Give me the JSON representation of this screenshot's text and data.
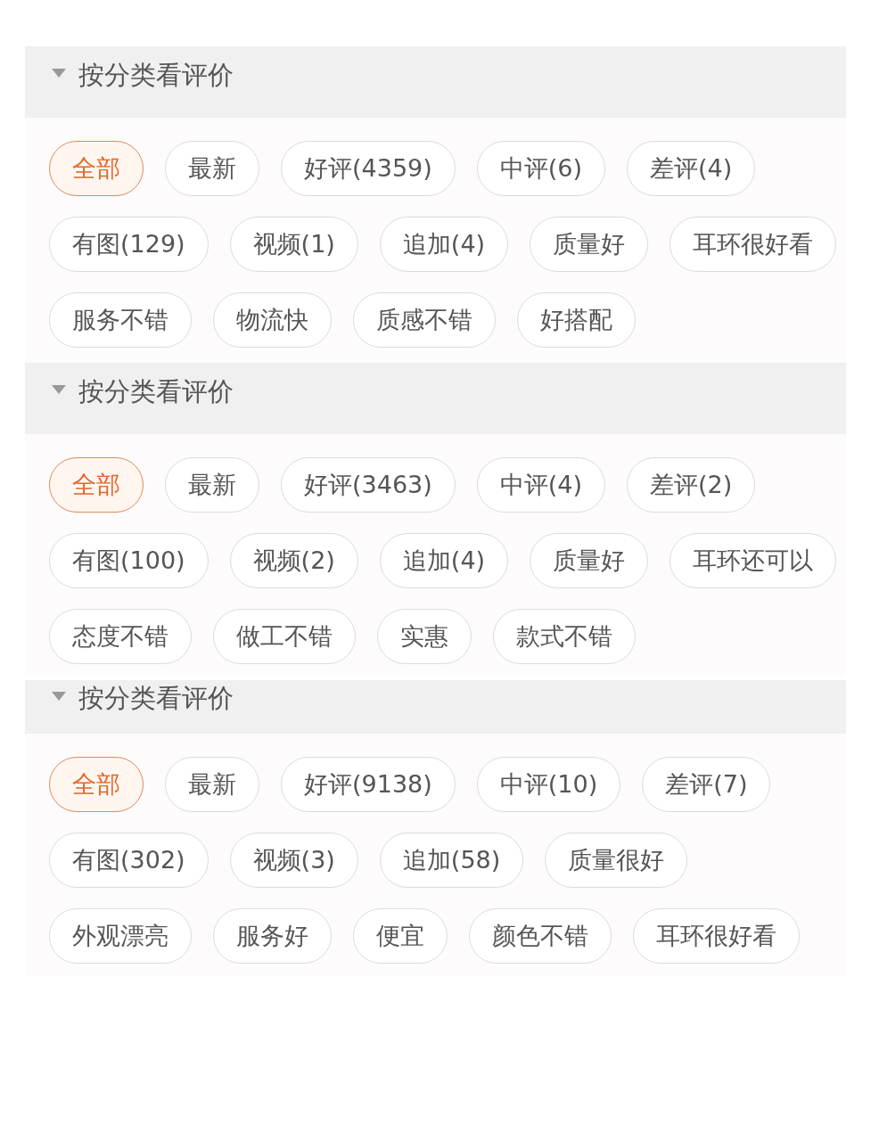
{
  "sections": [
    {
      "title": "按分类看评价",
      "expanded": true,
      "tags": [
        {
          "label": "全部",
          "selected": true
        },
        {
          "label": "最新",
          "selected": false
        },
        {
          "label": "好评(4359)",
          "selected": false
        },
        {
          "label": "中评(6)",
          "selected": false
        },
        {
          "label": "差评(4)",
          "selected": false
        },
        {
          "label": "有图(129)",
          "selected": false
        },
        {
          "label": "视频(1)",
          "selected": false
        },
        {
          "label": "追加(4)",
          "selected": false
        },
        {
          "label": "质量好",
          "selected": false
        },
        {
          "label": "耳环很好看",
          "selected": false
        },
        {
          "label": "服务不错",
          "selected": false
        },
        {
          "label": "物流快",
          "selected": false
        },
        {
          "label": "质感不错",
          "selected": false
        },
        {
          "label": "好搭配",
          "selected": false
        }
      ]
    },
    {
      "title": "按分类看评价",
      "expanded": true,
      "tags": [
        {
          "label": "全部",
          "selected": true
        },
        {
          "label": "最新",
          "selected": false
        },
        {
          "label": "好评(3463)",
          "selected": false
        },
        {
          "label": "中评(4)",
          "selected": false
        },
        {
          "label": "差评(2)",
          "selected": false
        },
        {
          "label": "有图(100)",
          "selected": false
        },
        {
          "label": "视频(2)",
          "selected": false
        },
        {
          "label": "追加(4)",
          "selected": false
        },
        {
          "label": "质量好",
          "selected": false
        },
        {
          "label": "耳环还可以",
          "selected": false
        },
        {
          "label": "态度不错",
          "selected": false
        },
        {
          "label": "做工不错",
          "selected": false
        },
        {
          "label": "实惠",
          "selected": false
        },
        {
          "label": "款式不错",
          "selected": false
        }
      ]
    },
    {
      "title": "按分类看评价",
      "expanded": true,
      "tags": [
        {
          "label": "全部",
          "selected": true
        },
        {
          "label": "最新",
          "selected": false
        },
        {
          "label": "好评(9138)",
          "selected": false
        },
        {
          "label": "中评(10)",
          "selected": false
        },
        {
          "label": "差评(7)",
          "selected": false
        },
        {
          "label": "有图(302)",
          "selected": false
        },
        {
          "label": "视频(3)",
          "selected": false
        },
        {
          "label": "追加(58)",
          "selected": false
        },
        {
          "label": "质量很好",
          "selected": false
        },
        {
          "label": "外观漂亮",
          "selected": false
        },
        {
          "label": "服务好",
          "selected": false
        },
        {
          "label": "便宜",
          "selected": false
        },
        {
          "label": "颜色不错",
          "selected": false
        },
        {
          "label": "耳环很好看",
          "selected": false
        }
      ]
    }
  ]
}
